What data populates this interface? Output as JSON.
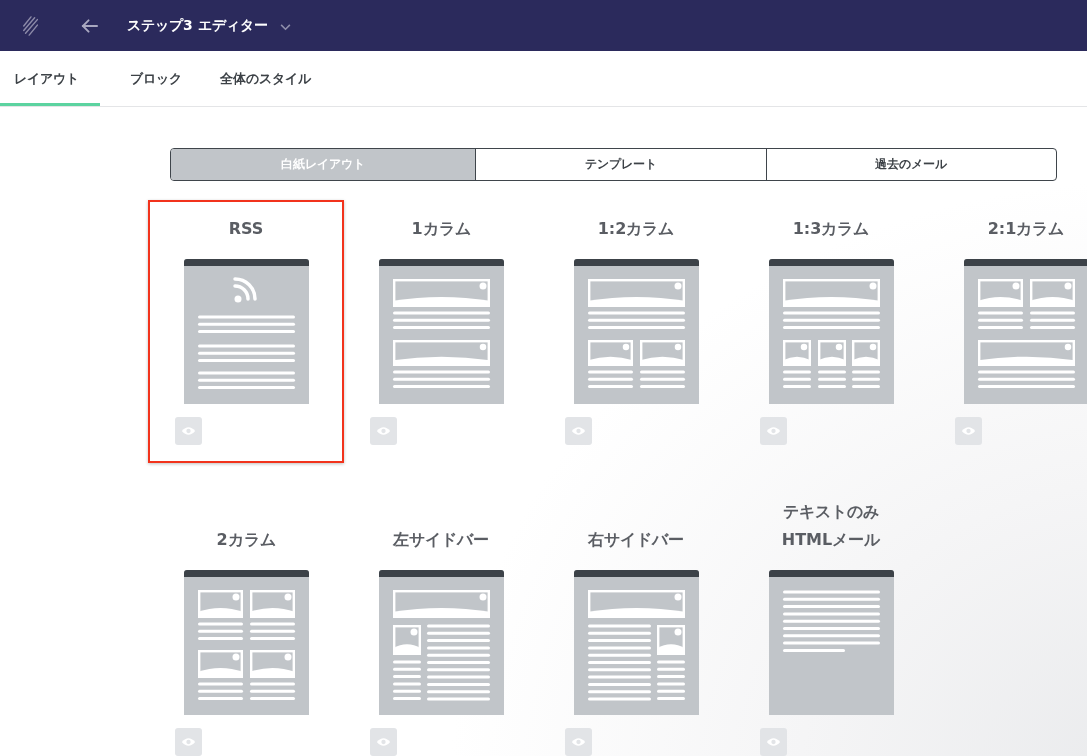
{
  "header": {
    "title": "ステップ3 エディター"
  },
  "tabs": [
    {
      "label": "レイアウト",
      "selected": true
    },
    {
      "label": "ブロック",
      "selected": false
    },
    {
      "label": "全体のスタイル",
      "selected": false
    }
  ],
  "segments": [
    {
      "label": "白紙レイアウト",
      "selected": true
    },
    {
      "label": "テンプレート",
      "selected": false
    },
    {
      "label": "過去のメール",
      "selected": false
    }
  ],
  "layouts": [
    {
      "title": "RSS",
      "kind": "rss",
      "selected": true
    },
    {
      "title": "1カラム",
      "kind": "one-col",
      "selected": false
    },
    {
      "title": "1:2カラム",
      "kind": "one-two",
      "selected": false
    },
    {
      "title": "1:3カラム",
      "kind": "one-three",
      "selected": false
    },
    {
      "title": "2:1カラム",
      "kind": "two-one",
      "selected": false
    },
    {
      "title": "2カラム",
      "kind": "two-col",
      "selected": false
    },
    {
      "title": "左サイドバー",
      "kind": "left-sidebar",
      "selected": false
    },
    {
      "title": "右サイドバー",
      "kind": "right-sidebar",
      "selected": false
    },
    {
      "title": "テキストのみ\nHTMLメール",
      "kind": "text-only",
      "selected": false
    }
  ]
}
